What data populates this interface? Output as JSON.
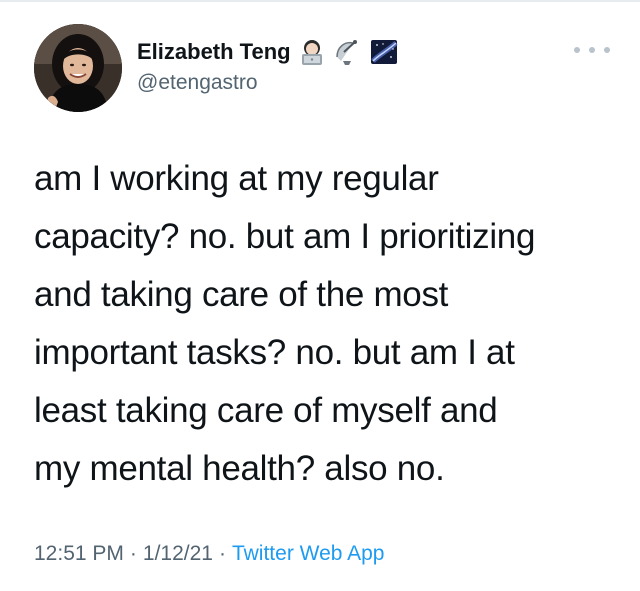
{
  "tweet": {
    "author": {
      "display_name": "Elizabeth Teng",
      "handle": "@etengastro",
      "name_emojis": [
        "woman-technologist-emoji-icon",
        "satellite-dish-emoji-icon",
        "milky-way-emoji-icon"
      ]
    },
    "text": "am I working at my regular\ncapacity? no. but am I prioritizing\nand taking care of the most\nimportant tasks? no. but am I at\nleast taking care of myself and\nmy mental health? also no.",
    "time": "12:51 PM",
    "separator": "·",
    "date": "1/12/21",
    "source": "Twitter Web App",
    "more_icon": "more-horizontal-icon"
  },
  "colors": {
    "text_primary": "#0f1419",
    "text_secondary": "#536471",
    "link": "#1d9bf0",
    "rule": "#e6ecf0"
  }
}
